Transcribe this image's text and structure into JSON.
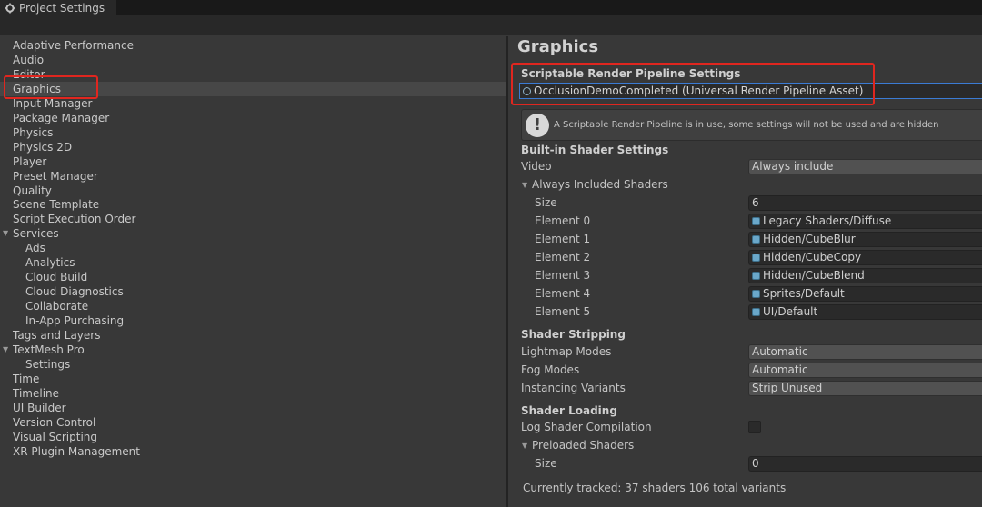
{
  "window": {
    "tab_title": "Project Settings",
    "tab_icon": "gear-icon"
  },
  "sidebar": {
    "items": [
      {
        "label": "Adaptive Performance",
        "indent": 0
      },
      {
        "label": "Audio",
        "indent": 0
      },
      {
        "label": "Editor",
        "indent": 0
      },
      {
        "label": "Graphics",
        "indent": 0,
        "selected": true
      },
      {
        "label": "Input Manager",
        "indent": 0
      },
      {
        "label": "Package Manager",
        "indent": 0
      },
      {
        "label": "Physics",
        "indent": 0
      },
      {
        "label": "Physics 2D",
        "indent": 0
      },
      {
        "label": "Player",
        "indent": 0
      },
      {
        "label": "Preset Manager",
        "indent": 0
      },
      {
        "label": "Quality",
        "indent": 0
      },
      {
        "label": "Scene Template",
        "indent": 0
      },
      {
        "label": "Script Execution Order",
        "indent": 0
      },
      {
        "label": "Services",
        "indent": 0,
        "expanded": true
      },
      {
        "label": "Ads",
        "indent": 1
      },
      {
        "label": "Analytics",
        "indent": 1
      },
      {
        "label": "Cloud Build",
        "indent": 1
      },
      {
        "label": "Cloud Diagnostics",
        "indent": 1
      },
      {
        "label": "Collaborate",
        "indent": 1
      },
      {
        "label": "In-App Purchasing",
        "indent": 1
      },
      {
        "label": "Tags and Layers",
        "indent": 0
      },
      {
        "label": "TextMesh Pro",
        "indent": 0,
        "expanded": true
      },
      {
        "label": "Settings",
        "indent": 1
      },
      {
        "label": "Time",
        "indent": 0
      },
      {
        "label": "Timeline",
        "indent": 0
      },
      {
        "label": "UI Builder",
        "indent": 0
      },
      {
        "label": "Version Control",
        "indent": 0
      },
      {
        "label": "Visual Scripting",
        "indent": 0
      },
      {
        "label": "XR Plugin Management",
        "indent": 0
      }
    ]
  },
  "main": {
    "title": "Graphics",
    "srp": {
      "header": "Scriptable Render Pipeline Settings",
      "asset": "OcclusionDemoCompleted (Universal Render Pipeline Asset)"
    },
    "help_message": "A Scriptable Render Pipeline is in use, some settings will not be used and are hidden",
    "builtin": {
      "header": "Built-in Shader Settings",
      "video_label": "Video",
      "video_value": "Always include",
      "always_included_label": "Always Included Shaders",
      "size_label": "Size",
      "size_value": "6",
      "elements": [
        {
          "label": "Element 0",
          "value": "Legacy Shaders/Diffuse"
        },
        {
          "label": "Element 1",
          "value": "Hidden/CubeBlur"
        },
        {
          "label": "Element 2",
          "value": "Hidden/CubeCopy"
        },
        {
          "label": "Element 3",
          "value": "Hidden/CubeBlend"
        },
        {
          "label": "Element 4",
          "value": "Sprites/Default"
        },
        {
          "label": "Element 5",
          "value": "UI/Default"
        }
      ]
    },
    "stripping": {
      "header": "Shader Stripping",
      "rows": [
        {
          "label": "Lightmap Modes",
          "value": "Automatic"
        },
        {
          "label": "Fog Modes",
          "value": "Automatic"
        },
        {
          "label": "Instancing Variants",
          "value": "Strip Unused"
        }
      ]
    },
    "loading": {
      "header": "Shader Loading",
      "log_label": "Log Shader Compilation",
      "log_checked": false,
      "preloaded_label": "Preloaded Shaders",
      "size_label": "Size",
      "size_value": "0"
    },
    "status": "Currently tracked: 37 shaders 106 total variants"
  },
  "colors": {
    "highlight": "#e0261f",
    "selection": "#474747",
    "object_field_border": "#3b7bd4"
  }
}
